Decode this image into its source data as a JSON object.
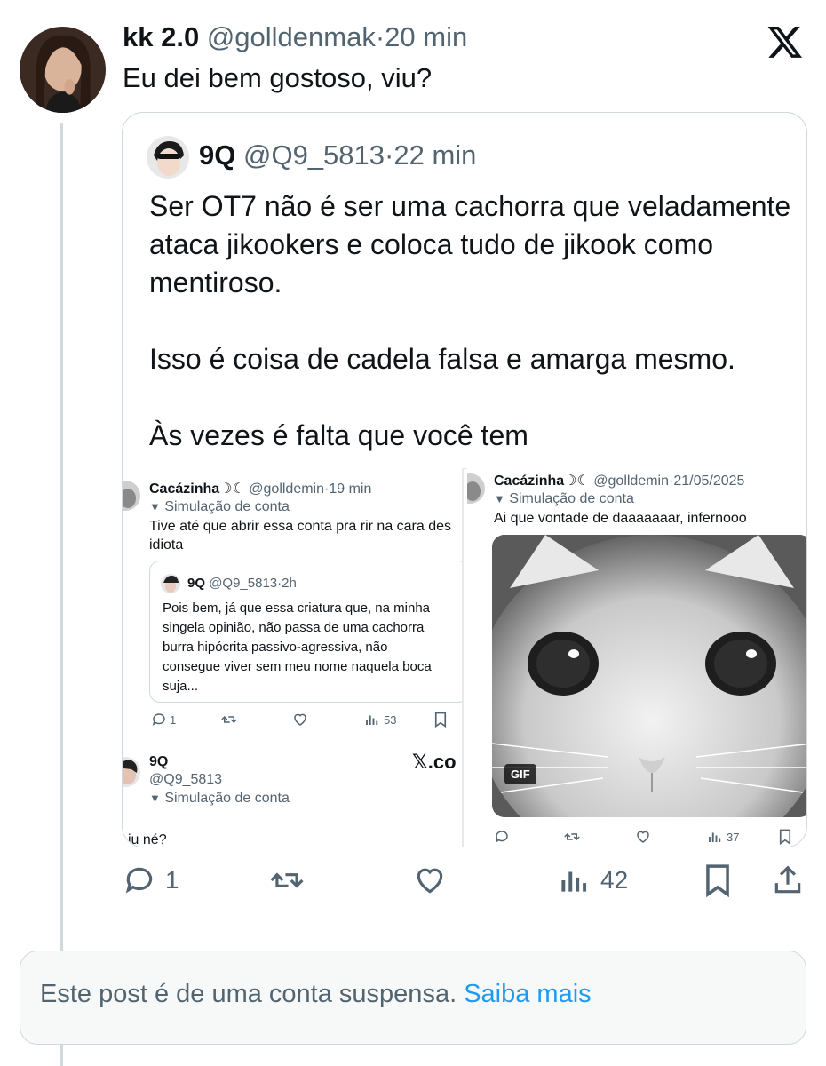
{
  "post": {
    "display_name": "kk 2.0",
    "handle": "@golldenmak",
    "separator": "·",
    "time": "20 min",
    "text": "Eu dei bem gostoso, viu?"
  },
  "quoted": {
    "display_name": "9Q",
    "handle": "@Q9_5813",
    "separator": "·",
    "time": "22 min",
    "paragraphs": [
      "Ser OT7 não é ser uma cachorra que veladamente ataca jikookers e coloca tudo de jikook como mentiroso.",
      "Isso é coisa de cadela falsa e amarga mesmo.",
      "Às vezes é falta que você tem"
    ]
  },
  "screenshot_left": {
    "display_name": "Cacázinha☽☾",
    "handle": "@goll demin",
    "handle_text": "@golldemin",
    "time": "19 min",
    "label": "Simulação de conta",
    "text_lines": [
      "Tive até que abrir essa conta pra rir na cara des",
      "idiota"
    ],
    "inner": {
      "display_name": "9Q",
      "handle": "@Q9_5813",
      "time": "2h",
      "lines": [
        "Pois bem, já que essa criatura que, na minha",
        "singela opinião, não passa de uma cachorra",
        "burra hipócrita passivo-agressiva, não",
        "consegue viver sem meu nome naquela boca",
        "suja..."
      ]
    },
    "replies": "1",
    "views": "53",
    "second": {
      "display_name": "9Q",
      "handle": "@Q9_5813",
      "label": "Simulação de conta",
      "brand": "𝕏.co",
      "cut_text": "iu né?"
    }
  },
  "screenshot_right": {
    "display_name": "Cacázinha☽☾",
    "handle": "@golldemin",
    "date": "21/05/2025",
    "label": "Simulação de conta",
    "text": "Ai que vontade de daaaaaaar, infernooo",
    "gif_badge": "GIF",
    "views": "37"
  },
  "actions": {
    "replies": "1",
    "views": "42"
  },
  "notice": {
    "text": "Este post é de uma conta suspensa.",
    "link": "Saiba mais"
  },
  "colors": {
    "accent": "#1d9bf0",
    "muted": "#536471",
    "border": "#cfd9de",
    "notice_bg": "#f7f9f9"
  }
}
